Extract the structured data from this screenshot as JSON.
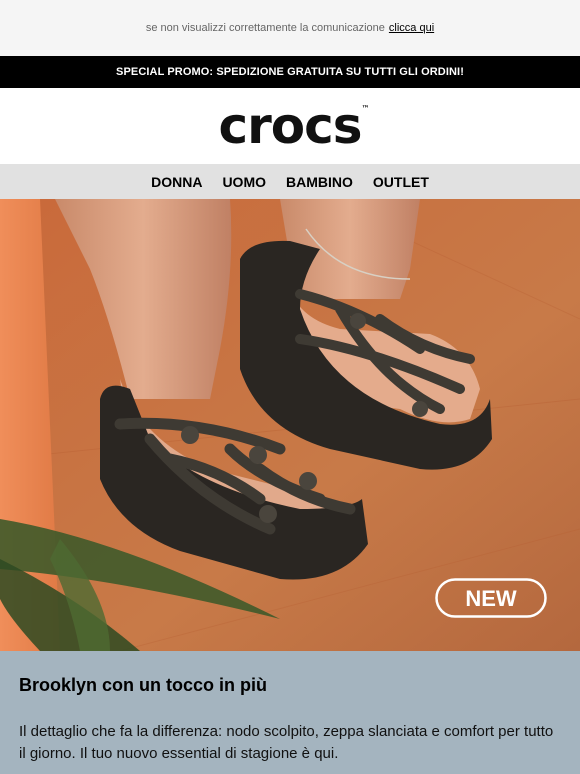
{
  "preheader": {
    "text": "se non visualizzi correttamente la comunicazione",
    "link_label": "clicca qui"
  },
  "promo": {
    "text": "SPECIAL PROMO: SPEDIZIONE GRATUITA SU TUTTI GLI ORDINI!"
  },
  "brand": {
    "logo_text": "crocs",
    "trademark": "™"
  },
  "nav": {
    "items": [
      {
        "label": "DONNA"
      },
      {
        "label": "UOMO"
      },
      {
        "label": "BAMBINO"
      },
      {
        "label": "OUTLET"
      }
    ]
  },
  "hero": {
    "badge_label": "NEW",
    "icon": "product-photo-sandals",
    "colors": {
      "floor": "#c8703a",
      "wall": "#e8854f",
      "sandal": "#2a2622",
      "strap": "#3e3a33"
    }
  },
  "content": {
    "title": "Brooklyn con un tocco in più",
    "body": "Il dettaglio che fa la differenza: nodo scolpito, zeppa slanciata e comfort per tutto il giorno. Il tuo nuovo essential di stagione è qui."
  }
}
